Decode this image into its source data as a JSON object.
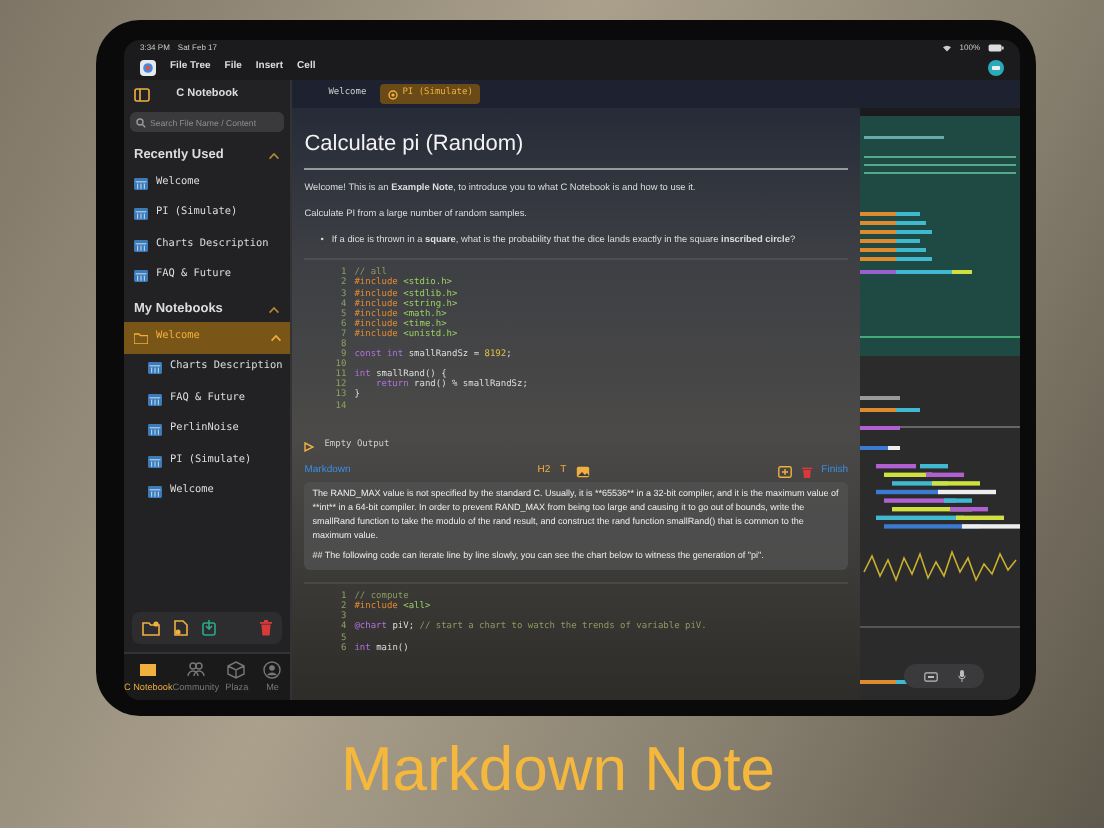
{
  "status_bar": {
    "time": "3:34 PM",
    "date": "Sat Feb 17",
    "battery": "100%"
  },
  "menu_bar": [
    "File Tree",
    "File",
    "Insert",
    "Cell"
  ],
  "sidebar": {
    "title": "C Notebook",
    "search": {
      "placeholder": "Search File Name / Content"
    },
    "sections": [
      {
        "title": "Recently Used",
        "expanded": true,
        "items": [
          {
            "label": "Welcome",
            "kind": "file",
            "selected": false
          },
          {
            "label": "PI (Simulate)",
            "kind": "file",
            "selected": false
          },
          {
            "label": "Charts Description",
            "kind": "file",
            "selected": false
          },
          {
            "label": "FAQ & Future",
            "kind": "file",
            "selected": false
          }
        ]
      },
      {
        "title": "My Notebooks",
        "expanded": true,
        "items": [
          {
            "label": "Welcome",
            "kind": "folder",
            "selected": true,
            "expanded": true,
            "children": [
              {
                "label": "Charts Description",
                "kind": "file",
                "selected": false
              },
              {
                "label": "FAQ & Future",
                "kind": "file",
                "selected": false
              },
              {
                "label": "PerlinNoise",
                "kind": "file",
                "selected": false
              },
              {
                "label": "PI (Simulate)",
                "kind": "file",
                "selected": false
              },
              {
                "label": "Welcome",
                "kind": "file",
                "selected": false
              }
            ]
          }
        ]
      }
    ]
  },
  "bottom_tabs": [
    {
      "label": "C Notebook",
      "selected": true
    },
    {
      "label": "Community",
      "selected": false
    },
    {
      "label": "Plaza",
      "selected": false
    },
    {
      "label": "Me",
      "selected": false
    }
  ],
  "editor_tabs": [
    {
      "label": "Welcome",
      "selected": false
    },
    {
      "label": "PI (Simulate)",
      "selected": true
    }
  ],
  "note": {
    "title": "Calculate pi (Random)",
    "paragraphs": [
      "Welcome! This is an **Example Note**, to introduce you to what C Notebook is and how to use it.",
      "Calculate PI from a large number of random samples."
    ],
    "bullets": [
      {
        "marker": "•",
        "text": "If a dice is thrown in a **square**, what is the probability that the dice lands exactly in the square **inscribed circle**?"
      }
    ],
    "code_cell": [
      {
        "number": "1",
        "tokens": [
          {
            "text": "// all",
            "kind": "comment"
          }
        ]
      },
      {
        "number": "2",
        "tokens": [
          {
            "text": "#include",
            "kind": "directive"
          },
          {
            "text": " <stdio.h>",
            "kind": "string"
          }
        ]
      },
      {
        "number": "3",
        "tokens": [
          {
            "text": "#include",
            "kind": "directive"
          },
          {
            "text": " <stdlib.h>",
            "kind": "string"
          }
        ]
      },
      {
        "number": "4",
        "tokens": [
          {
            "text": "#include",
            "kind": "directive"
          },
          {
            "text": " <string.h>",
            "kind": "string"
          }
        ]
      },
      {
        "number": "5",
        "tokens": [
          {
            "text": "#include",
            "kind": "directive"
          },
          {
            "text": " <math.h>",
            "kind": "string"
          }
        ]
      },
      {
        "number": "6",
        "tokens": [
          {
            "text": "#include",
            "kind": "directive"
          },
          {
            "text": " <time.h>",
            "kind": "string"
          }
        ]
      },
      {
        "number": "7",
        "tokens": [
          {
            "text": "#include",
            "kind": "directive"
          },
          {
            "text": " <unistd.h>",
            "kind": "string"
          }
        ]
      },
      {
        "number": "8"
      },
      {
        "number": "9",
        "tokens": [
          {
            "text": "const int",
            "kind": "keyword"
          },
          {
            "text": " smallRandSz = ",
            "kind": "plain"
          },
          {
            "text": "8192",
            "kind": "number"
          },
          {
            "text": ";",
            "kind": "plain"
          }
        ]
      },
      {
        "number": "10"
      },
      {
        "number": "11",
        "tokens": [
          {
            "text": "int",
            "kind": "keyword"
          },
          {
            "text": " smallRand() {",
            "kind": "plain"
          }
        ]
      },
      {
        "number": "12",
        "tokens": [
          {
            "text": "    return",
            "kind": "keyword"
          },
          {
            "text": " rand() % smallRandSz;",
            "kind": "plain"
          }
        ]
      },
      {
        "number": "13",
        "tokens": [
          {
            "text": "}",
            "kind": "plain"
          }
        ]
      },
      {
        "number": "14"
      }
    ],
    "output": "Empty Output",
    "markdown_cell": {
      "label": "Markdown",
      "format_buttons": [
        "H2",
        "T"
      ],
      "finish": "Finish",
      "text": [
        "The RAND_MAX value is not specified by the standard C. Usually, it is **65536** in a 32-bit compiler, and it is the maximum value of **int** in a 64-bit compiler. In order to prevent RAND_MAX from being too large and causing it to go out of bounds, write the smallRand function to take the modulo of the rand result, and construct the rand function smallRand() that is common to the maximum value.",
        "## The following code can iterate line by line slowly, you can see the chart below to witness the generation of \"pi\"."
      ]
    },
    "code_cell_2": [
      {
        "number": "1",
        "tokens": [
          {
            "text": "// compute",
            "kind": "comment"
          }
        ]
      },
      {
        "number": "2",
        "tokens": [
          {
            "text": "#include",
            "kind": "directive"
          },
          {
            "text": " <all>",
            "kind": "string"
          }
        ]
      },
      {
        "number": "3"
      },
      {
        "number": "4",
        "tokens": [
          {
            "text": "@chart",
            "kind": "keyword"
          },
          {
            "text": " piV; ",
            "kind": "plain"
          },
          {
            "text": "// start a chart to watch the trends of variable piV.",
            "kind": "comment"
          }
        ]
      },
      {
        "number": "5"
      },
      {
        "number": "6",
        "tokens": [
          {
            "text": "int",
            "kind": "keyword"
          },
          {
            "text": " main()",
            "kind": "plain"
          }
        ]
      }
    ]
  },
  "caption": "Markdown Note"
}
